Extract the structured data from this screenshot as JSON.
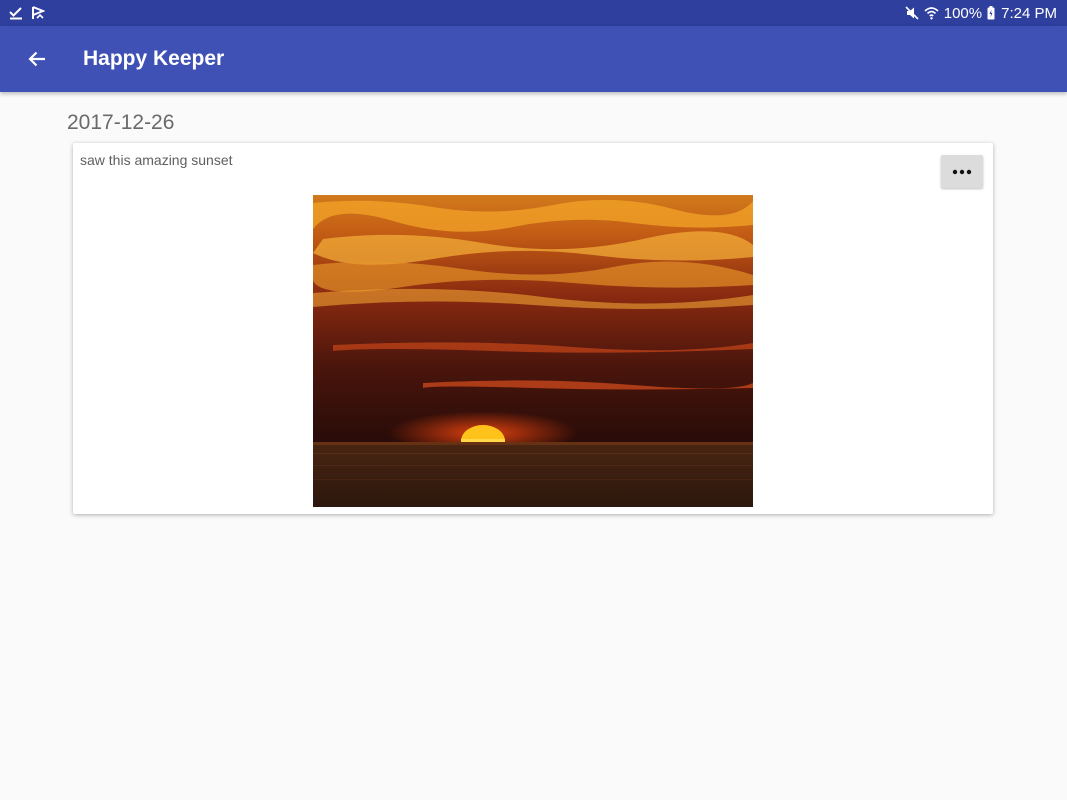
{
  "status_bar": {
    "battery": "100%",
    "time": "7:24 PM",
    "icons": [
      "check-icon",
      "flag-icon",
      "mute-icon",
      "wifi-icon",
      "battery-icon"
    ]
  },
  "app_bar": {
    "title": "Happy Keeper",
    "back_icon": "arrow-left-icon",
    "color": "#3f51b5"
  },
  "entry": {
    "date": "2017-12-26",
    "text": "saw this amazing sunset",
    "more_icon": "more-horizontal-icon",
    "photo": "sunset-photo"
  }
}
